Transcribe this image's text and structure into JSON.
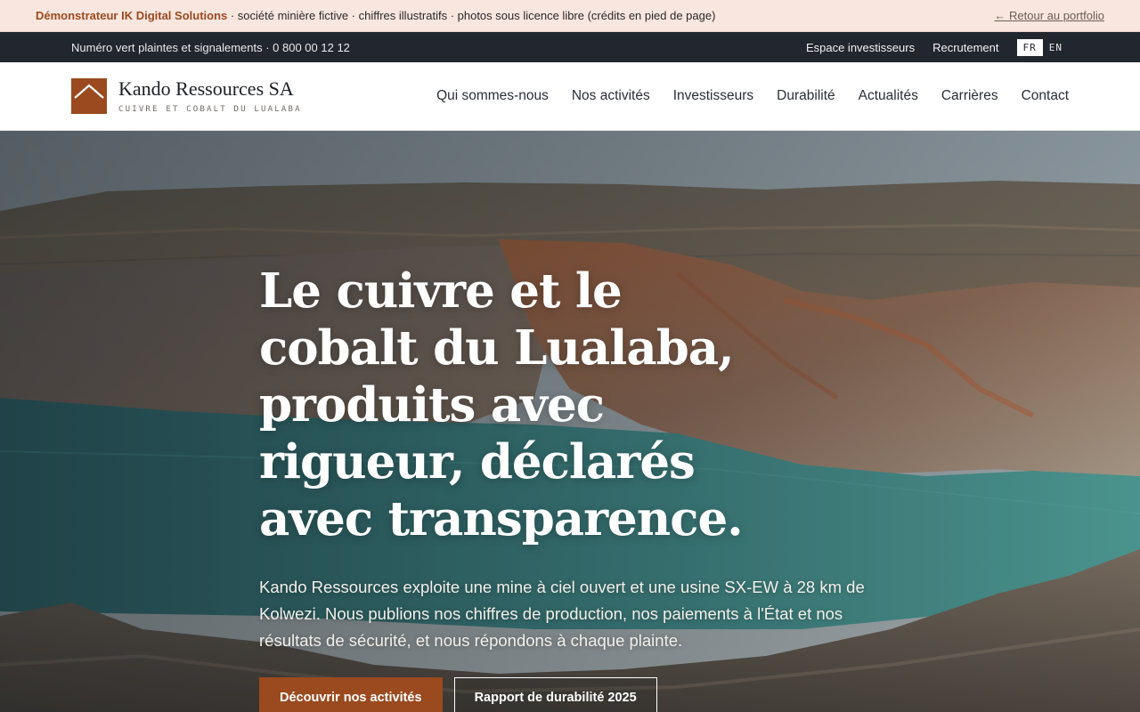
{
  "demo_banner": {
    "brand": "Démonstrateur IK Digital Solutions",
    "text": " · société minière fictive · chiffres illustratifs · photos sous licence libre (crédits en pied de page)",
    "back_link": "← Retour au portfolio"
  },
  "utility_bar": {
    "hotline_label": "Numéro vert plaintes et signalements · ",
    "hotline_number": "0 800 00 12 12",
    "links": [
      "Espace investisseurs",
      "Recrutement"
    ],
    "languages": [
      {
        "code": "FR",
        "active": true
      },
      {
        "code": "EN",
        "active": false
      }
    ]
  },
  "header": {
    "brand_name": "Kando Ressources SA",
    "tagline": "CUIVRE ET COBALT DU LUALABA",
    "nav": [
      "Qui sommes-nous",
      "Nos activités",
      "Investisseurs",
      "Durabilité",
      "Actualités",
      "Carrières",
      "Contact"
    ]
  },
  "hero": {
    "title": "Le cuivre et le cobalt du Lualaba, produits avec rigueur, déclarés avec transparence.",
    "lede": "Kando Ressources exploite une mine à ciel ouvert et une usine SX-EW à 28 km de Kolwezi. Nous publions nos chiffres de production, nos paiements à l'État et nos résultats de sécurité, et nous répondons à chaque plainte.",
    "primary_cta": "Découvrir nos activités",
    "secondary_cta": "Rapport de durabilité 2025",
    "background": "open-pit mine with turquoise lake"
  },
  "colors": {
    "accent": "#9a4a1e",
    "utility_bar": "#22262e",
    "demo_banner": "#f8e6df"
  },
  "icons": [
    "logo-roof-icon"
  ]
}
